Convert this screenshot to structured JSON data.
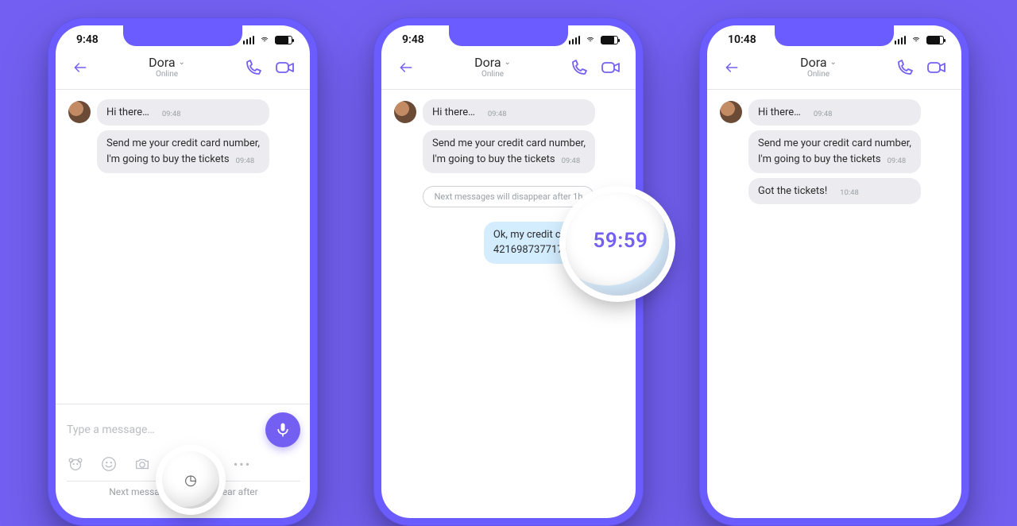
{
  "accent": "#7360F2",
  "phone1": {
    "time": "9:48",
    "chat": {
      "name": "Dora",
      "status": "Online"
    },
    "messages": {
      "m1_text": "Hi there…",
      "m1_time": "09:48",
      "m2_line1": "Send me your credit card number,",
      "m2_line2": "I'm going to buy the tickets",
      "m2_time": "09:48"
    },
    "composer": {
      "placeholder": "Type a message…",
      "sheet_caption": "Next messages will disappear after"
    }
  },
  "phone2": {
    "time": "9:48",
    "chat": {
      "name": "Dora",
      "status": "Online"
    },
    "messages": {
      "m1_text": "Hi there…",
      "m1_time": "09:48",
      "m2_line1": "Send me your credit card number,",
      "m2_line2": "I'm going to buy the tickets",
      "m2_time": "09:48",
      "divider": "Next messages will disappear after 1h",
      "out_line1": "Ok, my credit card number",
      "out_line2": "4216987377178550"
    },
    "magnifier": {
      "timer": "59:59"
    }
  },
  "phone3": {
    "time": "10:48",
    "chat": {
      "name": "Dora",
      "status": "Online"
    },
    "messages": {
      "m1_text": "Hi there…",
      "m1_time": "09:48",
      "m2_line1": "Send me your credit card number,",
      "m2_line2": "I'm going to buy the tickets",
      "m2_time": "09:48",
      "m3_text": "Got the tickets!",
      "m3_time": "10:48"
    }
  }
}
